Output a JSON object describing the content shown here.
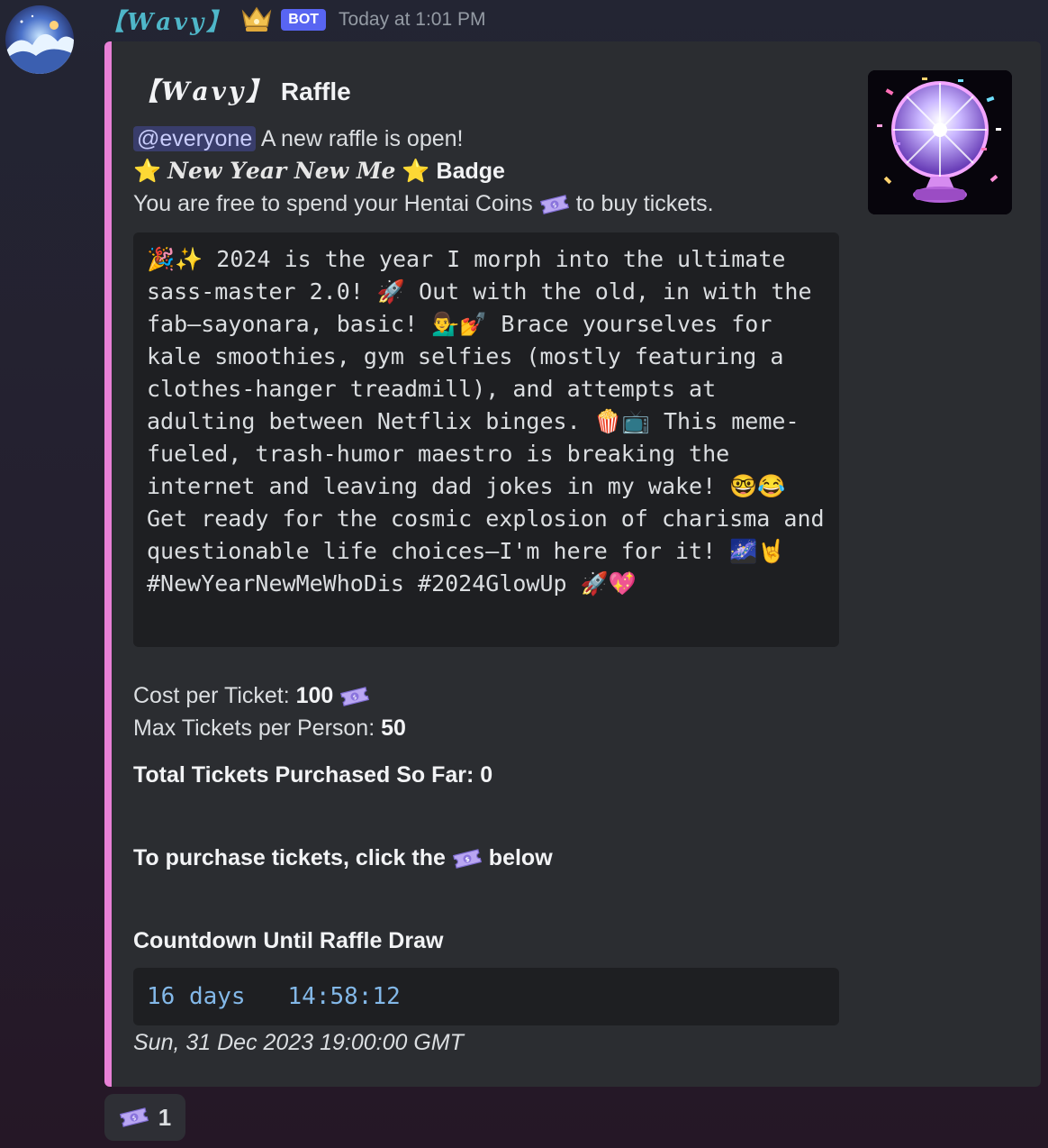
{
  "message": {
    "username": "【𝑾𝒂𝒗𝒚】",
    "bot_tag": "BOT",
    "timestamp": "Today at 1:01 PM"
  },
  "embed": {
    "accent_color": "#e880d6",
    "title_fancy": "【𝑾𝒂𝒗𝒚】",
    "title_text": "Raffle",
    "mention": "@everyone",
    "intro": "A new raffle is open!",
    "badge_star": "⭐",
    "badge_name": "𝑵𝒆𝒘 𝒀𝒆𝒂𝒓 𝑵𝒆𝒘 𝑴𝒆",
    "badge_suffix": "Badge",
    "spend_before": "You are free to spend your Hentai Coins",
    "spend_after": "to buy tickets.",
    "code_text": "🎉✨ 2024 is the year I morph into the ultimate sass-master 2.0! 🚀 Out with the old, in with the fab—sayonara, basic! 💁‍♂️💅 Brace yourselves for kale smoothies, gym selfies (mostly featuring a clothes-hanger treadmill), and attempts at adulting between Netflix binges. 🍿📺 This meme-fueled, trash-humor maestro is breaking the internet and leaving dad jokes in my wake! 🤓😂 Get ready for the cosmic explosion of charisma and questionable life choices—I'm here for it! 🌌🤘 #NewYearNewMeWhoDis #2024GlowUp 🚀💖",
    "cost_label": "Cost per Ticket:",
    "cost_value": "100",
    "max_label": "Max Tickets per Person:",
    "max_value": "50",
    "total_label": "Total Tickets Purchased So Far: 0",
    "purchase_before": "To purchase tickets, click the",
    "purchase_after": "below",
    "countdown_heading": "Countdown Until Raffle Draw",
    "countdown_value": "16 days   14:58:12",
    "draw_date": "Sun, 31 Dec 2023 19:00:00 GMT"
  },
  "reaction": {
    "icon": "ticket-icon",
    "count": "1"
  },
  "colors": {
    "username": "#4fb7c9",
    "bot_tag": "#5865f2",
    "embed_bg": "#2b2d31",
    "code_bg": "#1e1f22",
    "countdown_text": "#83b8e8"
  }
}
